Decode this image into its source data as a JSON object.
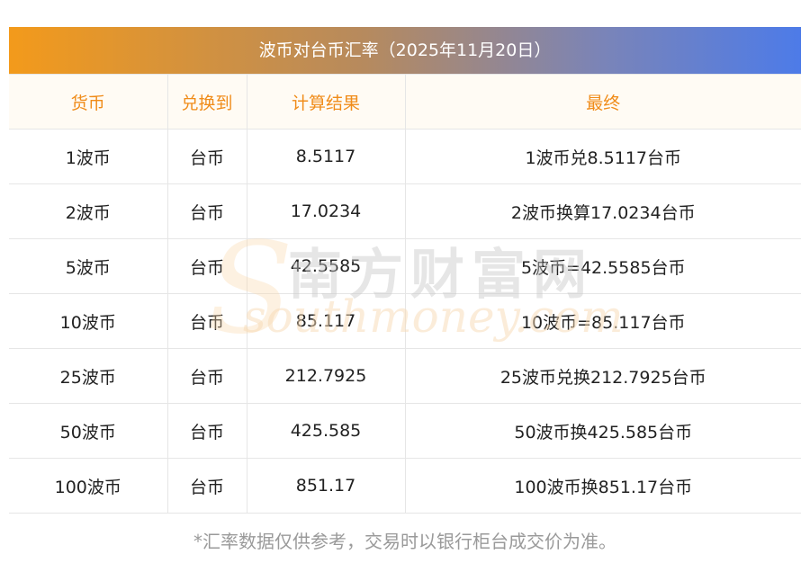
{
  "title": "波币对台币汇率（2025年11月20日）",
  "table": {
    "headers": [
      "货币",
      "兑换到",
      "计算结果",
      "最终"
    ],
    "rows": [
      [
        "1波币",
        "台币",
        "8.5117",
        "1波币兑8.5117台币"
      ],
      [
        "2波币",
        "台币",
        "17.0234",
        "2波币换算17.0234台币"
      ],
      [
        "5波币",
        "台币",
        "42.5585",
        "5波币=42.5585台币"
      ],
      [
        "10波币",
        "台币",
        "85.117",
        "10波币=85.117台币"
      ],
      [
        "25波币",
        "台币",
        "212.7925",
        "25波币兑换212.7925台币"
      ],
      [
        "50波币",
        "台币",
        "425.585",
        "50波币换425.585台币"
      ],
      [
        "100波币",
        "台币",
        "851.17",
        "100波币换851.17台币"
      ]
    ]
  },
  "watermark": {
    "cn": "南方财富网",
    "en": "southmoney.com"
  },
  "footnote": "*汇率数据仅供参考，交易时以银行柜台成交价为准。",
  "colors": {
    "header_text": "#f08c1a",
    "title_gradient_start": "#f39a1b",
    "title_gradient_end": "#4d7be8"
  }
}
